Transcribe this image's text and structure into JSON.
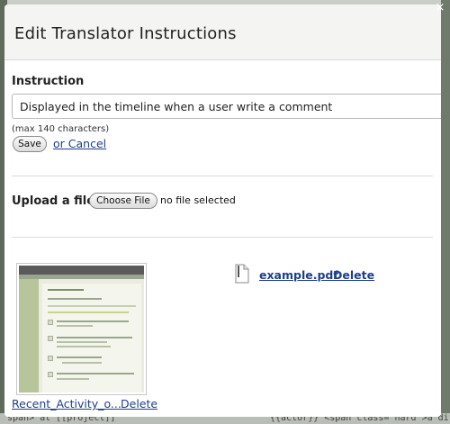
{
  "background": {
    "bottom_left_text": "span> at [[project]]",
    "bottom_right_text": "{{actor}} <span class=\"hard\">a diff</span>"
  },
  "dialog": {
    "title": "Edit Translator Instructions",
    "close_glyph": "×"
  },
  "instruction": {
    "label": "Instruction",
    "value": "Displayed in the timeline when a user write a comment",
    "hint": "(max 140 characters)",
    "save_label": "Save",
    "cancel_label": "or Cancel"
  },
  "upload": {
    "label": "Upload a file",
    "button_label": "Choose File",
    "status": "no file selected"
  },
  "attachments": {
    "image": {
      "caption": "Recent_Activity_o...",
      "delete_label": "Delete"
    },
    "file": {
      "name": "example.pdf",
      "delete_label": "Delete",
      "icon": "document-icon"
    }
  },
  "colors": {
    "link": "#1f3f8a",
    "header_bg": "#f4f5f3"
  }
}
